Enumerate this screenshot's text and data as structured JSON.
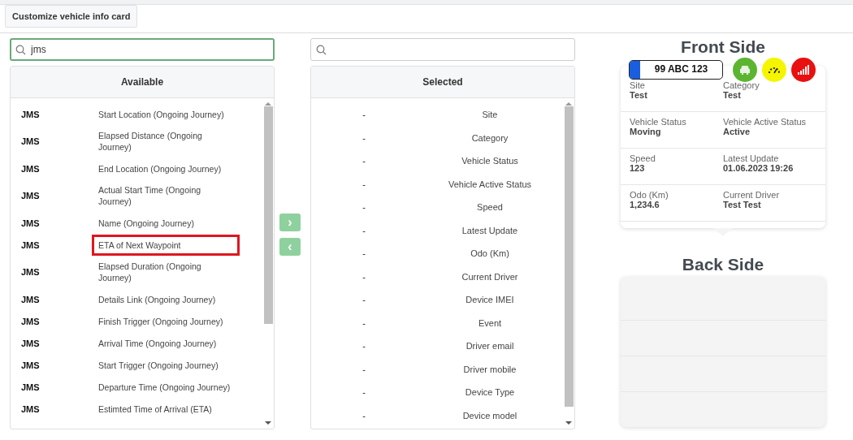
{
  "tab": {
    "label": "Customize vehicle info card",
    "selected": true
  },
  "available": {
    "search": {
      "value": "jms"
    },
    "title": "Available",
    "items": [
      {
        "source": "JMS",
        "name": "Start Location (Ongoing Journey)",
        "highlighted": false
      },
      {
        "source": "JMS",
        "name": "Elapsed Distance (Ongoing Journey)",
        "highlighted": false
      },
      {
        "source": "JMS",
        "name": "End Location (Ongoing Journey)",
        "highlighted": false
      },
      {
        "source": "JMS",
        "name": "Actual Start Time (Ongoing Journey)",
        "highlighted": false
      },
      {
        "source": "JMS",
        "name": "Name (Ongoing Journey)",
        "highlighted": false
      },
      {
        "source": "JMS",
        "name": "ETA of Next Waypoint",
        "highlighted": true
      },
      {
        "source": "JMS",
        "name": "Elapsed Duration (Ongoing Journey)",
        "highlighted": false
      },
      {
        "source": "JMS",
        "name": "Details Link (Ongoing Journey)",
        "highlighted": false
      },
      {
        "source": "JMS",
        "name": "Finish Trigger (Ongoing Journey)",
        "highlighted": false
      },
      {
        "source": "JMS",
        "name": "Arrival Time (Ongoing Journey)",
        "highlighted": false
      },
      {
        "source": "JMS",
        "name": "Start Trigger (Ongoing Journey)",
        "highlighted": false
      },
      {
        "source": "JMS",
        "name": "Departure Time (Ongoing Journey)",
        "highlighted": false
      },
      {
        "source": "JMS",
        "name": "Estimted Time of Arrival (ETA)",
        "highlighted": false
      }
    ]
  },
  "transfer_buttons": [
    {
      "label": "›"
    },
    {
      "label": "‹"
    }
  ],
  "selected": {
    "title": "Selected",
    "items": [
      {
        "source": "-",
        "name": "Site"
      },
      {
        "source": "-",
        "name": "Category"
      },
      {
        "source": "-",
        "name": "Vehicle Status"
      },
      {
        "source": "-",
        "name": "Vehicle Active Status"
      },
      {
        "source": "-",
        "name": "Speed"
      },
      {
        "source": "-",
        "name": "Latest Update"
      },
      {
        "source": "-",
        "name": "Odo (Km)"
      },
      {
        "source": "-",
        "name": "Current Driver"
      },
      {
        "source": "-",
        "name": "Device IMEI"
      },
      {
        "source": "-",
        "name": "Event"
      },
      {
        "source": "-",
        "name": "Driver email"
      },
      {
        "source": "-",
        "name": "Driver mobile"
      },
      {
        "source": "-",
        "name": "Device Type"
      },
      {
        "source": "-",
        "name": "Device model"
      }
    ]
  },
  "front": {
    "title": "Front Side",
    "plate": "99 ABC 123",
    "status_icons": [
      {
        "kind": "car",
        "color": "#5cb531"
      },
      {
        "kind": "gauge",
        "color": "#f5f500"
      },
      {
        "kind": "signal",
        "color": "#e81010"
      }
    ],
    "rows": [
      [
        {
          "label": "Site",
          "value": "Test"
        },
        {
          "label": "Category",
          "value": "Test"
        }
      ],
      [
        {
          "label": "Vehicle Status",
          "value": "Moving"
        },
        {
          "label": "Vehicle Active Status",
          "value": "Active"
        }
      ],
      [
        {
          "label": "Speed",
          "value": "123"
        },
        {
          "label": "Latest Update",
          "value": "01.06.2023 19:26"
        }
      ],
      [
        {
          "label": "Odo (Km)",
          "value": "1,234.6"
        },
        {
          "label": "Current Driver",
          "value": "Test Test"
        }
      ]
    ]
  },
  "back": {
    "title": "Back Side"
  }
}
